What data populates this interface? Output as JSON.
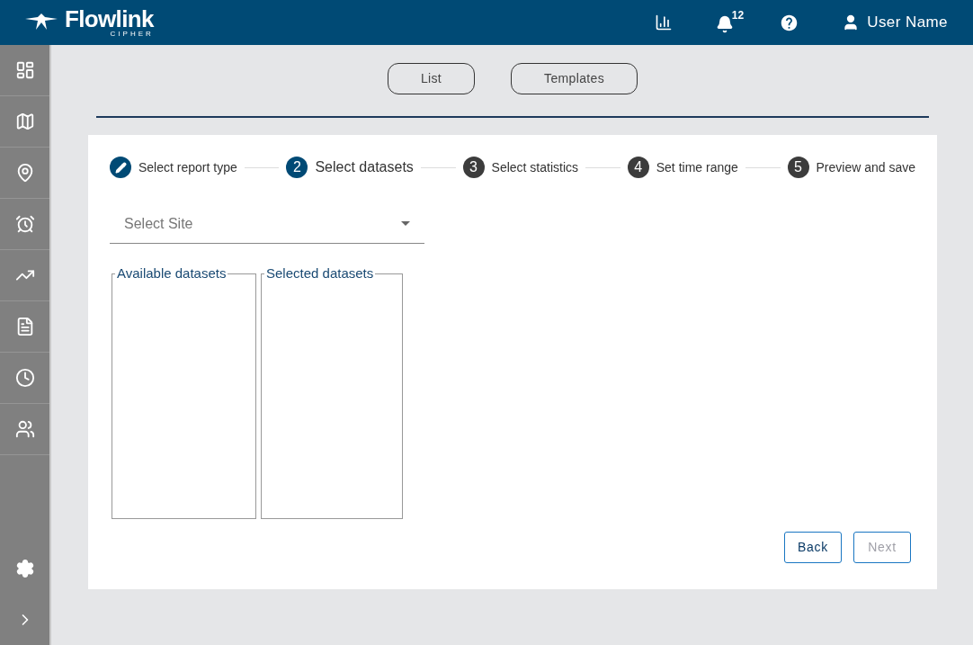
{
  "header": {
    "logo_text": "Flowlink",
    "logo_subtext": "CIPHER",
    "notification_count": "12",
    "user_name": "User Name"
  },
  "view_buttons": [
    "List",
    "Templates"
  ],
  "steps": [
    {
      "kind": "done",
      "label": "Select report type"
    },
    {
      "kind": "active",
      "number": "2",
      "label": "Select datasets"
    },
    {
      "kind": "pending",
      "number": "3",
      "label": "Select statistics"
    },
    {
      "kind": "pending",
      "number": "4",
      "label": "Set time range"
    },
    {
      "kind": "pending",
      "number": "5",
      "label": "Preview and save"
    }
  ],
  "site_select": {
    "placeholder": "Select Site"
  },
  "dataset_lists": [
    {
      "legend": "Available datasets"
    },
    {
      "legend": "Selected datasets"
    }
  ],
  "actions": [
    {
      "label": "Back",
      "disabled": false
    },
    {
      "label": "Next",
      "disabled": true
    }
  ]
}
